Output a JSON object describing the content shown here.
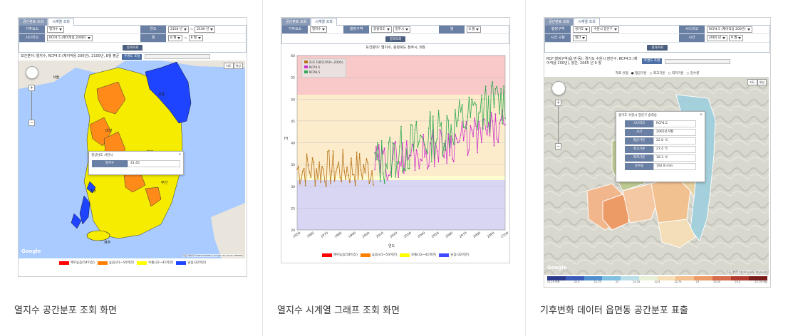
{
  "captions": [
    "열지수 공간분포 조회 화면",
    "열지수 시계열 그래프 조회 화면",
    "기후변화 데이터 읍면동 공간분포 표출"
  ],
  "panel1": {
    "tabs": [
      "공간분포 조회",
      "시계열 조회"
    ],
    "row1": {
      "label": "기후요소",
      "value": "열지수",
      "label2": "연도",
      "from": "2100 년",
      "to": "2100 년"
    },
    "row2": {
      "label": "시나리오",
      "value": "RCP4.5 (제어적용 200년)",
      "label2": "월",
      "from": "8 월",
      "to": "8 월"
    },
    "button": "결과조회",
    "info": "보건분야: 열지수, RCP4.5 (제어적용 200년), 2100년, 8월 평균",
    "opacity_btn": "투명도 조절",
    "maptype": [
      "지도",
      "위성"
    ],
    "popup": {
      "title": "경상남도 사천시",
      "key": "열지수",
      "value": "41.45"
    },
    "places": [
      "서울",
      "강릉",
      "대전",
      "전주",
      "광주",
      "대구",
      "부산",
      "제주"
    ],
    "google": "Google",
    "copyright": "지도 데이터 ©2015 AutoNavi, Google, SK planet, ZENRIN",
    "legend": [
      {
        "label": "매우높음(54이상)",
        "color": "#ff0000"
      },
      {
        "label": "높음(41~54미만)",
        "color": "#ff7f00"
      },
      {
        "label": "보통(32~41미만)",
        "color": "#ffff00"
      },
      {
        "label": "낮음(32미만)",
        "color": "#1e44ff"
      }
    ]
  },
  "panel2": {
    "tabs": [
      "공간분포 조회",
      "시계열 조회"
    ],
    "row": {
      "l1": "기후요소",
      "v1": "열지수",
      "l2": "행정구역",
      "v2": "충청북도",
      "v3": "청주시",
      "l3": "월",
      "v4": "8 월"
    },
    "button": "결과조회",
    "title": "보건분야: 열지수, 충청북도 청주시, 8월",
    "ylabel": "HI",
    "xlabel": "연도",
    "legend_items": [
      {
        "label": "과거 자료(1950~2005)",
        "color": "#b8741a"
      },
      {
        "label": "RCP4.5",
        "color": "#cc33cc"
      },
      {
        "label": "RCP8.5",
        "color": "#33aa55"
      }
    ],
    "bottom_legend": [
      {
        "label": "매우높음(54이상)",
        "color": "#ff0000"
      },
      {
        "label": "높음(41~54미만)",
        "color": "#ff7f00"
      },
      {
        "label": "보통(32~41미만)",
        "color": "#ffff00"
      },
      {
        "label": "낮음(32미만)",
        "color": "#3d4bff"
      }
    ]
  },
  "panel3": {
    "tabs": [
      "공간분포 조회",
      "시계열 조회"
    ],
    "row1": {
      "label": "행정구역",
      "v1": "경기도",
      "v2": "수원시 장안구",
      "label2": "시나리오",
      "v3": "RCP4.5 (제어적용 200년)"
    },
    "row2": {
      "label": "시간 구분",
      "v1": "월간",
      "label2": "시간",
      "v2": "2065 년",
      "v3": "9 월"
    },
    "button": "결과조회",
    "info": "RCP 행정구역(읍·면·동): 경기도 수원시 장안구, RCP4.5 (제어적용 200년), 월간, 2065 년 9 월",
    "opacity_btn": "투명도 조절",
    "options": [
      "평균기온",
      "최고기온",
      "최저기온",
      "강수량"
    ],
    "option_label": "자료 유형",
    "maptype": [
      "지도",
      "위성"
    ],
    "popup": {
      "title": "경기도 수원시 장안구 송죽동",
      "rows": [
        {
          "k": "시나리오",
          "v": "RCP4.5"
        },
        {
          "k": "시간",
          "v": "2065년 9월"
        },
        {
          "k": "평균기온",
          "v": "22.8 ℃"
        },
        {
          "k": "최고기온",
          "v": "27.4 ℃"
        },
        {
          "k": "최저기온",
          "v": "18.3 ℃"
        },
        {
          "k": "강수량",
          "v": "192.8 mm"
        }
      ]
    },
    "google": "Google",
    "copyright": "지도 데이터 ©2014 Google, SK planet",
    "scale_labels": [
      "21.19 이하",
      "21.5",
      "21.75",
      "22",
      "22.25",
      "22.5",
      "22.75",
      "23",
      "23.25",
      "23.5",
      "23.75 이상"
    ],
    "scale_colors": [
      "#2b3a8c",
      "#3a5bb8",
      "#4f8fd0",
      "#7fc0e0",
      "#b9dfe9",
      "#e8f0d8",
      "#f6dfb7",
      "#f4c08d",
      "#ec9a66",
      "#d66a4a",
      "#b03b2e",
      "#7a1d1d"
    ]
  },
  "colors": {
    "divider": "#e6e6e6",
    "caption": "#333333"
  }
}
